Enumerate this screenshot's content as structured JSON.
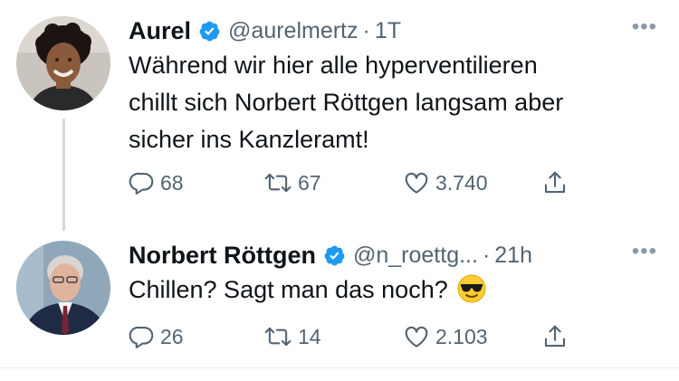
{
  "tweets": [
    {
      "name": "Aurel",
      "handle": "@aurelmertz",
      "separator": "·",
      "time": "1T",
      "more": "•••",
      "text": "Während wir hier alle hyperventilieren\nchillt sich Norbert Röttgen langsam aber\nsicher ins Kanzleramt!",
      "replies": "68",
      "retweets": "67",
      "likes": "3.740",
      "verified": true
    },
    {
      "name": "Norbert Röttgen",
      "handle": "@n_roettg...",
      "separator": "·",
      "time": "21h",
      "more": "•••",
      "text": "Chillen? Sagt man das noch?",
      "emoji": "smiling-face-with-sunglasses",
      "replies": "26",
      "retweets": "14",
      "likes": "2.103",
      "verified": true
    }
  ],
  "colors": {
    "verified_blue": "#1d9bf0",
    "secondary_text": "#536471",
    "thread_line": "#cfd9de"
  },
  "icons": [
    "reply-icon",
    "retweet-icon",
    "like-icon",
    "share-icon",
    "verified-badge-icon",
    "more-options-icon"
  ]
}
